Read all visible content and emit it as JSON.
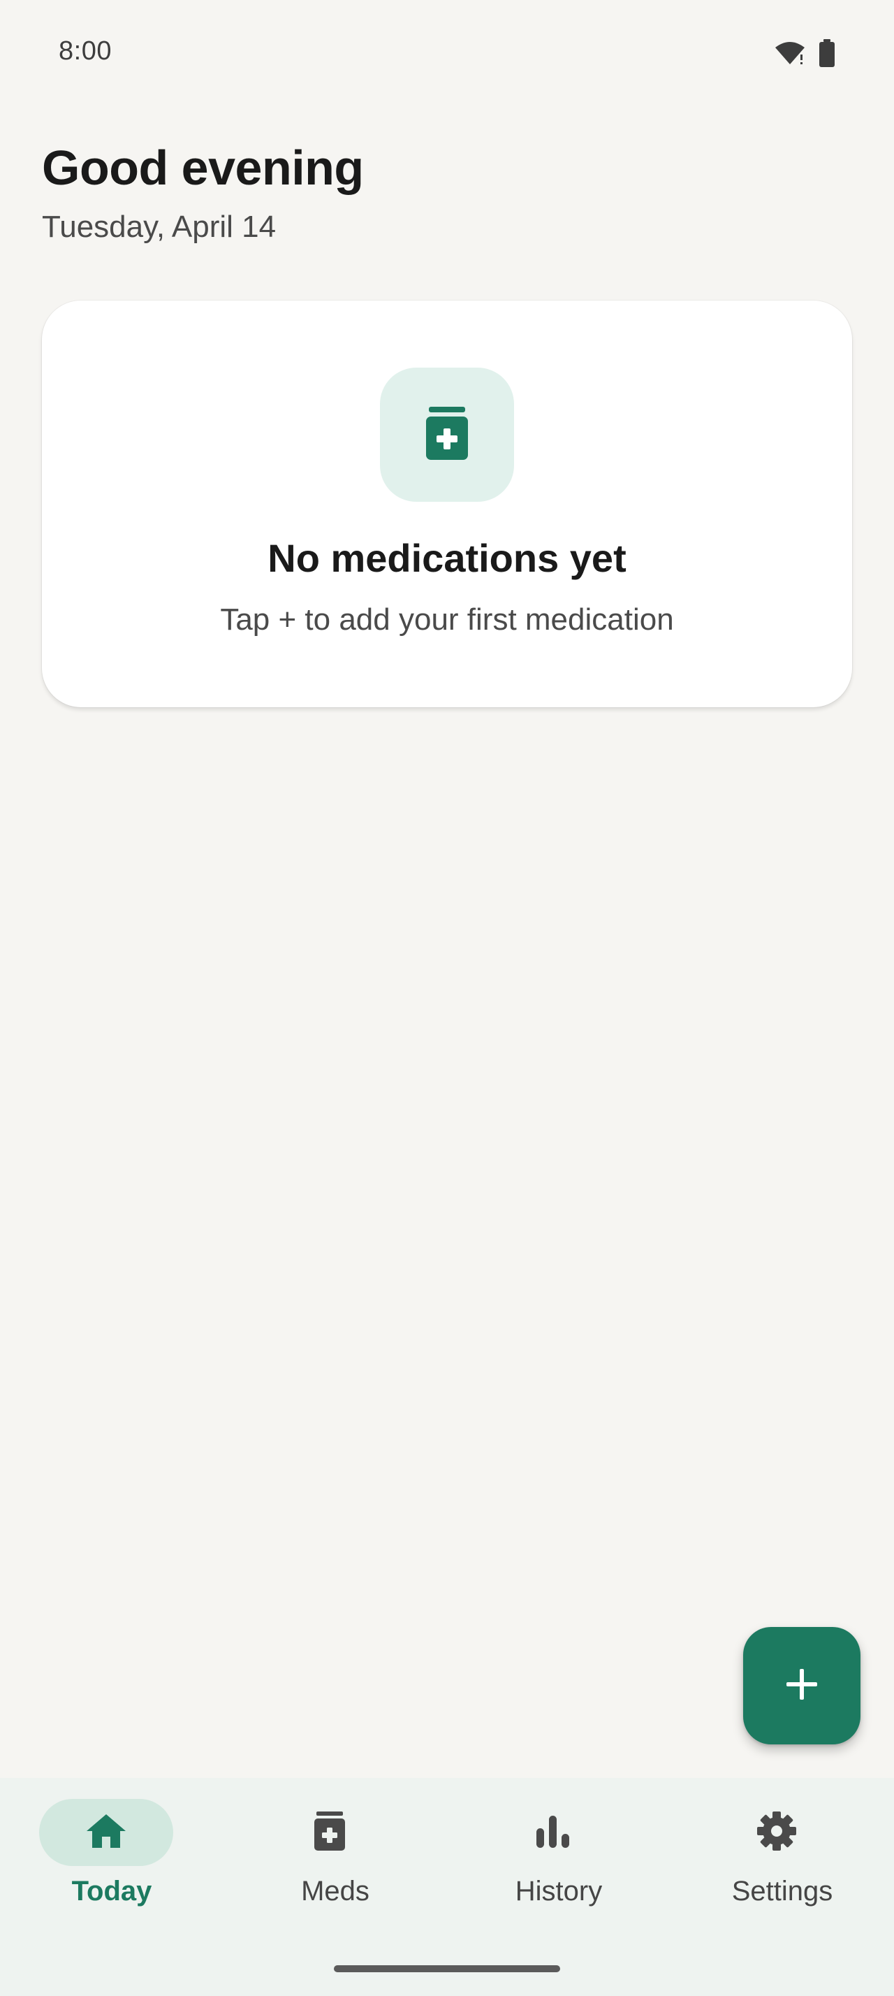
{
  "status_bar": {
    "time": "8:00",
    "icons": [
      "wifi-alert-icon",
      "battery-icon"
    ]
  },
  "header": {
    "greeting": "Good evening",
    "date": "Tuesday, April 14"
  },
  "empty_state": {
    "icon": "medication-bottle-icon",
    "title": "No medications yet",
    "subtitle": "Tap + to add your first medication"
  },
  "fab": {
    "icon": "plus-icon"
  },
  "bottom_nav": {
    "items": [
      {
        "label": "Today",
        "icon": "home-icon",
        "active": true
      },
      {
        "label": "Meds",
        "icon": "medication-bottle-icon",
        "active": false
      },
      {
        "label": "History",
        "icon": "bar-chart-icon",
        "active": false
      },
      {
        "label": "Settings",
        "icon": "gear-icon",
        "active": false
      }
    ]
  },
  "colors": {
    "background": "#f6f5f2",
    "accent": "#1c7a60",
    "accent_soft": "#e1f1ec",
    "nav_background": "#eef3f0",
    "nav_active_pill": "#d2e8df"
  }
}
